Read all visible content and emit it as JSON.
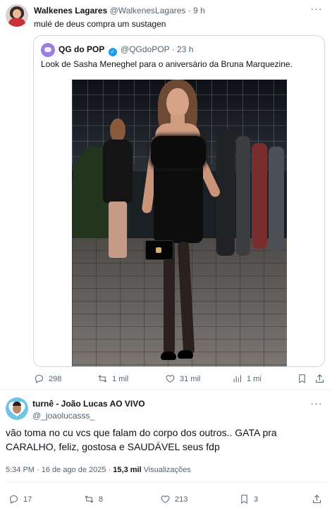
{
  "quoting_tweet": {
    "display_name": "Walkenes Lagares",
    "handle": "@WalkenesLagares",
    "separator": "·",
    "time": "9 h",
    "more_glyph": "···",
    "text": "mulé de deus compra um sustagen",
    "quoted": {
      "display_name": "QG do POP",
      "handle": "@QGdoPOP",
      "separator": "·",
      "time": "23 h",
      "text": "Look de Sasha Meneghel para o aniversário da Bruna Marquezine."
    },
    "stats": {
      "replies": "298",
      "reposts": "1 mil",
      "likes": "31 mil",
      "views": "1 mi"
    }
  },
  "reply_tweet": {
    "display_name": "turnê - João Lucas AO VIVO",
    "handle": "@_joaolucasss_",
    "more_glyph": "···",
    "text": "vão toma no cu vcs que falam do corpo dos outros.. GATA pra CARALHO, feliz, gostosa e SAUDÁVEL seus fdp",
    "timestamp": "5:34 PM · 16 de ago de 2025 · ",
    "views_count": "15,3 mil",
    "views_label": " Visualizações",
    "stats": {
      "replies": "17",
      "reposts": "8",
      "likes": "213",
      "bookmarks": "3"
    }
  },
  "colors": {
    "text": "#0f1419",
    "muted": "#536471",
    "border": "#cfd9de",
    "verified": "#1d9bf0"
  }
}
